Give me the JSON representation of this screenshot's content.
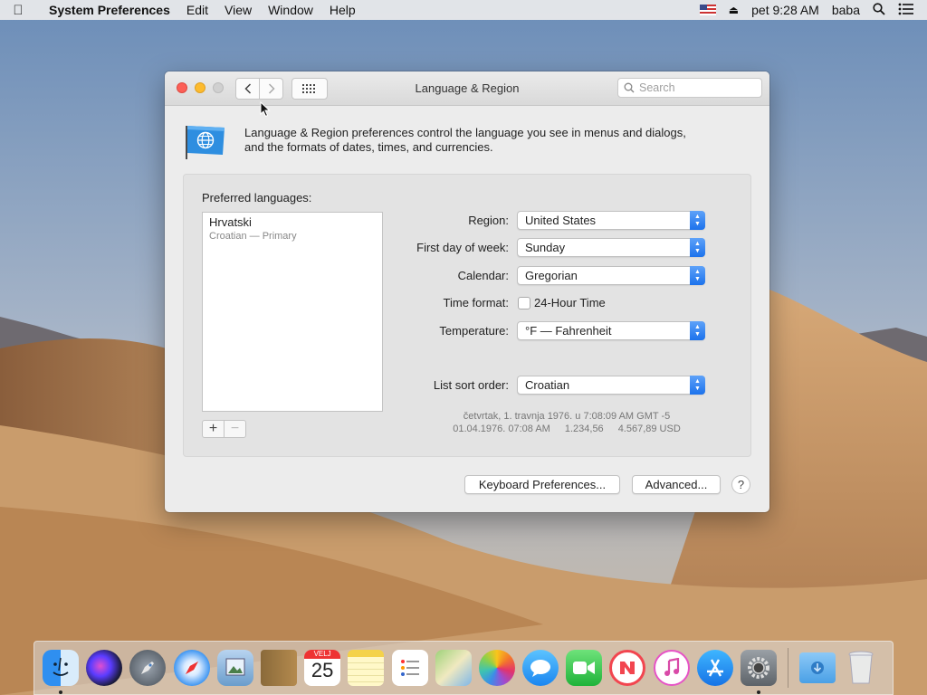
{
  "menubar": {
    "app_name": "System Preferences",
    "menus": [
      "Edit",
      "View",
      "Window",
      "Help"
    ],
    "clock": "pet 9:28 AM",
    "user": "baba"
  },
  "window": {
    "title": "Language & Region",
    "search_placeholder": "Search",
    "description_line1": "Language & Region preferences control the language you see in menus and dialogs,",
    "description_line2": "and the formats of dates, times, and currencies."
  },
  "languages": {
    "label": "Preferred languages:",
    "items": [
      {
        "name": "Hrvatski",
        "sub": "Croatian — Primary"
      }
    ],
    "add_label": "+",
    "remove_label": "−"
  },
  "settings": {
    "region_label": "Region:",
    "region_value": "United States",
    "first_day_label": "First day of week:",
    "first_day_value": "Sunday",
    "calendar_label": "Calendar:",
    "calendar_value": "Gregorian",
    "time_format_label": "Time format:",
    "time_format_option": "24-Hour Time",
    "time_format_checked": false,
    "temperature_label": "Temperature:",
    "temperature_value": "°F — Fahrenheit",
    "sort_label": "List sort order:",
    "sort_value": "Croatian"
  },
  "sample": {
    "line1": "četvrtak, 1. travnja 1976. u 7:08:09 AM GMT -5",
    "date_time": "01.04.1976. 07:08 AM",
    "number": "1.234,56",
    "currency": "4.567,89 USD"
  },
  "buttons": {
    "keyboard": "Keyboard Preferences...",
    "advanced": "Advanced...",
    "help": "?"
  },
  "dock": {
    "calendar_month": "VELJ",
    "calendar_day": "25",
    "icons": [
      "finder-icon",
      "siri-icon",
      "launchpad-icon",
      "safari-icon",
      "preview-icon",
      "notes-book-icon",
      "calendar-icon",
      "notes-icon",
      "reminders-icon",
      "maps-icon",
      "photos-icon",
      "messages-icon",
      "facetime-icon",
      "news-icon",
      "itunes-icon",
      "app-store-icon",
      "system-preferences-icon",
      "downloads-folder-icon",
      "trash-icon"
    ]
  }
}
